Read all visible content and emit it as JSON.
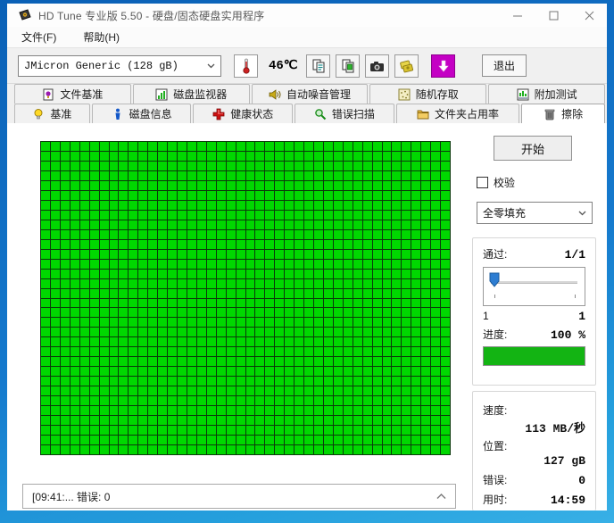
{
  "window": {
    "title": "HD Tune 专业版 5.50 - 硬盘/固态硬盘实用程序"
  },
  "menu": {
    "items": [
      {
        "label": "文件(F)"
      },
      {
        "label": "帮助(H)"
      }
    ]
  },
  "toolbar": {
    "drive_select": {
      "value": "JMicron Generic (128 gB)"
    },
    "temperature": "46℃",
    "exit_label": "退出",
    "icons": [
      "thermometer-icon",
      "copy-text-icon",
      "copy-image-icon",
      "camera-icon",
      "export-gold-icon",
      "download-arrow-icon"
    ]
  },
  "tabs": {
    "row1": [
      {
        "label": "文件基准",
        "icon": "file-benchmark-icon",
        "active": false
      },
      {
        "label": "磁盘监视器",
        "icon": "disk-monitor-icon",
        "active": false
      },
      {
        "label": "自动噪音管理",
        "icon": "noise-management-icon",
        "active": false
      },
      {
        "label": "随机存取",
        "icon": "random-access-icon",
        "active": false
      },
      {
        "label": "附加测试",
        "icon": "extra-tests-icon",
        "active": false
      }
    ],
    "row2": [
      {
        "label": "基准",
        "icon": "benchmark-icon",
        "active": false
      },
      {
        "label": "磁盘信息",
        "icon": "disk-info-icon",
        "active": false
      },
      {
        "label": "健康状态",
        "icon": "health-icon",
        "active": false
      },
      {
        "label": "错误扫描",
        "icon": "error-scan-icon",
        "active": false
      },
      {
        "label": "文件夹占用率",
        "icon": "folder-usage-icon",
        "active": false
      },
      {
        "label": "擦除",
        "icon": "erase-icon",
        "active": true
      }
    ]
  },
  "erase_panel": {
    "start_label": "开始",
    "verify_label": "校验",
    "verify_checked": false,
    "fill_mode": "全零填充",
    "pass": {
      "label": "通过:",
      "value": "1/1",
      "slider_min": "1",
      "slider_max": "1"
    },
    "progress": {
      "label": "进度:",
      "value": "100 %",
      "percent": 100
    },
    "stats": [
      {
        "label": "速度:",
        "value": "113 MB/秒"
      },
      {
        "label": "位置:",
        "value": "127 gB"
      },
      {
        "label": "错误:",
        "value": "0"
      },
      {
        "label": "用时:",
        "value": "14:59"
      }
    ]
  },
  "scan_grid": {
    "rows": 32,
    "cols": 42,
    "status": "all-ok",
    "cell_color": "#00d800",
    "line_color": "#0c3a0c"
  },
  "status_log": {
    "entries": [
      {
        "text": "[09:41:...  错误: 0"
      }
    ]
  },
  "colors": {
    "accent_green": "#00d800",
    "grid_line": "#0c3a0c",
    "progress_green": "#13b413",
    "slider_blue": "#2d7dd2",
    "toolbar_purple": "#c400c4",
    "health_red": "#cc1111",
    "desktop_blue_top": "#0a60b6",
    "desktop_blue_bottom": "#38b0e6",
    "temp_red": "#cc2222"
  }
}
